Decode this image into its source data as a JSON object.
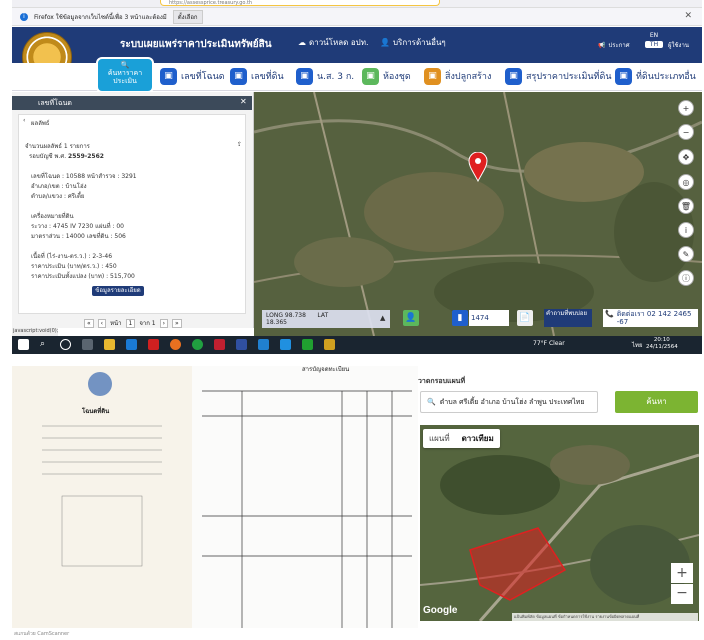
{
  "browser": {
    "url": "https://assessprice.treasury.go.th",
    "notice": "Firefox ใช้ข้อมูลจากเว็บไซต์นี้เพื่อ 3 หน้าและต้องมี",
    "notice_button": "ตั้งเลือก"
  },
  "header": {
    "site_title": "ระบบเผยแพร่ราคาประเมินทรัพย์สิน",
    "download": "ดาวน์โหลด อปท.",
    "service": "บริการด้านอื่นๆ",
    "announce": "ประกาศ",
    "lang_en": "EN",
    "lang_th": "TH",
    "user": "ผู้ใช้งาน"
  },
  "nav": {
    "search_price": "ค้นหาราคาประเมิน",
    "items": [
      {
        "label": "เลขที่โฉนด",
        "color": "#1f5fcc",
        "icon": "doc-icon"
      },
      {
        "label": "เลขที่ดิน",
        "color": "#1f5fcc",
        "icon": "land-icon"
      },
      {
        "label": "น.ส. 3 ก.",
        "color": "#1f5fcc",
        "icon": "book-icon"
      },
      {
        "label": "ห้องชุด",
        "color": "#5cb85c",
        "icon": "building-icon"
      },
      {
        "label": "สิ่งปลูกสร้าง",
        "color": "#e09020",
        "icon": "house-icon"
      },
      {
        "label": "สรุปราคาประเมินที่ดิน",
        "color": "#1f5fcc",
        "icon": "summary-icon"
      },
      {
        "label": "ที่ดินประเภทอื่น",
        "color": "#1f5fcc",
        "icon": "other-icon"
      }
    ]
  },
  "panel": {
    "title": "เลขที่โฉนด",
    "back_label": "ผลลัพธ์",
    "count": "จำนวนผลลัพธ์ 1 รายการ",
    "period_label": "รอบบัญชี พ.ศ.",
    "period": "2559-2562",
    "lines": [
      "เลขที่โฉนด : 10588 หน้าสำรวจ : 3291",
      "อำเภอ/เขต : บ้านโฮ่ง",
      "ตำบล/แขวง : ศรีเตี้ย",
      "เครื่องหมายที่ดิน",
      "ระวาง : 4745 IV 7230 แผ่นที่ : 00",
      "มาตราส่วน : 14000 เลขที่ดิน : 506",
      "เนื้อที่ (ไร่-งาน-ตร.ว.) : 2-3-46",
      "ราคาประเมิน (บาท/ตร.ว.) : 450",
      "ราคาประเมินทั้งแปลง (บาท) : 515,700"
    ],
    "detail_button": "ข้อมูลรายละเอียด",
    "pager_page": "หน้า",
    "pager_current": "1",
    "pager_of": "จาก 1"
  },
  "js_status": "javascript:void(0);",
  "map_bar": {
    "long_label": "LONG",
    "long_value": "98.738",
    "lat_label": "LAT",
    "lat_value": "18.365",
    "stat_count": "1474",
    "faq": "คำถามที่พบบ่อย",
    "contact_label": "ติดต่อเรา",
    "contact_phone": "02 142 2465 -67"
  },
  "taskbar": {
    "weather": "77°F Clear",
    "lang": "ไทย",
    "time": "20:10",
    "date": "24/11/2564"
  },
  "scan": {
    "deed_title": "โฉนดที่ดิน",
    "table_header": "สารบัญจดทะเบียน",
    "caption": "สแกนด้วย CamScanner"
  },
  "gmap": {
    "search_label": "วาดกรอบแผนที่",
    "search_value": "ตำบล ศรีเตี้ย อำเภอ บ้านโฮ่ง ลำพูน ประเทศไทย",
    "search_button": "ค้นหา",
    "tab_map": "แผนที่",
    "tab_satellite": "ดาวเทียม",
    "zoom_in": "+",
    "zoom_out": "−",
    "google": "Google",
    "footer": "แป้นพิมพ์ลัด   ข้อมูลแผนที่   ข้อกำหนดการใช้งาน   รายงานข้อผิดพลาดแผนที่"
  }
}
